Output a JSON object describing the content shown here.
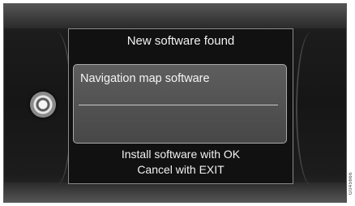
{
  "dialog": {
    "title": "New software found",
    "list_items": [
      "Navigation map software"
    ],
    "instruction_install": "Install software with OK",
    "instruction_cancel": "Cancel with EXIT"
  },
  "image_code": "G045666",
  "colors": {
    "screen_background": "#161616",
    "list_background": "#555555",
    "text": "#f2f2f2"
  },
  "icons": {
    "knob": "rotary-control-knob-icon"
  }
}
